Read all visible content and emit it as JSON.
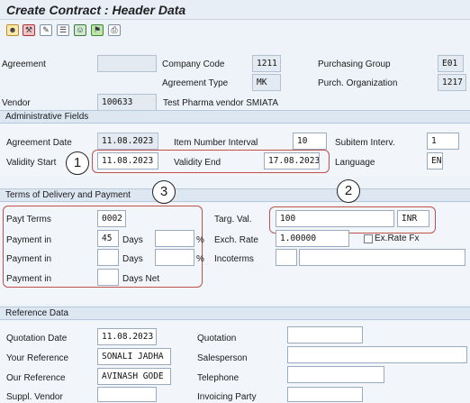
{
  "title": "Create Contract : Header Data",
  "toolbar": {
    "icons": [
      "person-icon",
      "tools-icon",
      "edit-icon",
      "document-icon",
      "people-icon",
      "flag-icon",
      "print-icon"
    ]
  },
  "header": {
    "agreement_label": "Agreement",
    "agreement_value": "",
    "company_code_label": "Company Code",
    "company_code_value": "1211",
    "purchasing_group_label": "Purchasing Group",
    "purchasing_group_value": "E01",
    "agreement_type_label": "Agreement Type",
    "agreement_type_value": "MK",
    "purch_org_label": "Purch. Organization",
    "purch_org_value": "1217",
    "vendor_label": "Vendor",
    "vendor_value": "100633",
    "vendor_name": "Test Pharma vendor SMIATA"
  },
  "admin": {
    "title": "Administrative Fields",
    "agreement_date_label": "Agreement Date",
    "agreement_date_value": "11.08.2023",
    "item_interval_label": "Item Number Interval",
    "item_interval_value": "10",
    "subitem_label": "Subitem Interv.",
    "subitem_value": "1",
    "validity_start_label": "Validity Start",
    "validity_start_value": "11.08.2023",
    "validity_end_label": "Validity End",
    "validity_end_value": "17.08.2023",
    "language_label": "Language",
    "language_value": "EN"
  },
  "terms": {
    "title": "Terms of Delivery and Payment",
    "payt_terms_label": "Payt Terms",
    "payt_terms_value": "0002",
    "payment1_label": "Payment in",
    "payment1_days_value": "45",
    "payment1_days_label": "Days",
    "payment1_pct_value": "",
    "pct_label": "%",
    "payment2_label": "Payment in",
    "payment2_days_value": "",
    "payment2_days_label": "Days",
    "payment2_pct_value": "",
    "payment3_label": "Payment in",
    "payment3_days_value": "",
    "payment3_days_label": "Days Net",
    "targ_val_label": "Targ. Val.",
    "targ_val_value": "100",
    "currency_value": "INR",
    "exch_rate_label": "Exch. Rate",
    "exch_rate_value": "1.00000",
    "ex_rate_fx_label": "Ex.Rate Fx",
    "incoterms_label": "Incoterms",
    "incoterms_value1": "",
    "incoterms_value2": ""
  },
  "reference": {
    "title": "Reference Data",
    "quotation_date_label": "Quotation Date",
    "quotation_date_value": "11.08.2023",
    "quotation_label": "Quotation",
    "quotation_value": "",
    "your_ref_label": "Your Reference",
    "your_ref_value": "SONALI JADHA",
    "salesperson_label": "Salesperson",
    "salesperson_value": "",
    "our_ref_label": "Our Reference",
    "our_ref_value": "AVINASH GODE",
    "telephone_label": "Telephone",
    "telephone_value": "",
    "suppl_vendor_label": "Suppl. Vendor",
    "suppl_vendor_value": "",
    "invoicing_party_label": "Invoicing Party",
    "invoicing_party_value": ""
  },
  "callouts": {
    "one": "1",
    "two": "2",
    "three": "3"
  },
  "colors": {
    "highlight": "#c0504d",
    "section": "#dde7f2",
    "background": "#eef3f9"
  }
}
